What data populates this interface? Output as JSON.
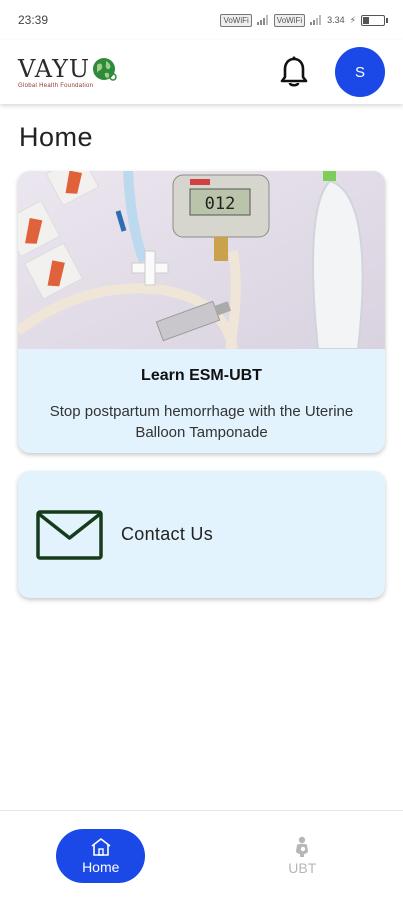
{
  "status_bar": {
    "time": "23:39",
    "net1": "VoWiFi",
    "net2": "VoWiFi",
    "speed": "3.34",
    "battery_level": 0.25
  },
  "app_bar": {
    "logo_text": "VAYU",
    "logo_tagline": "Global Health Foundation",
    "bell_icon": "bell-icon",
    "avatar_initial": "S",
    "avatar_color": "#1a49e8"
  },
  "page": {
    "title": "Home"
  },
  "learn_card": {
    "title": "Learn ESM-UBT",
    "subtitle": "Stop postpartum hemorrhage with the Uterine Balloon Tamponade",
    "image": "ubt-kit-photo",
    "gauge_reading": "012",
    "background": "#e2f3fd"
  },
  "contact_card": {
    "icon": "mail-icon",
    "label": "Contact Us"
  },
  "bottom_nav": {
    "items": [
      {
        "label": "Home",
        "icon": "home-icon",
        "active": true
      },
      {
        "label": "UBT",
        "icon": "ubt-icon",
        "active": false
      }
    ],
    "active_color": "#1a49e8"
  }
}
